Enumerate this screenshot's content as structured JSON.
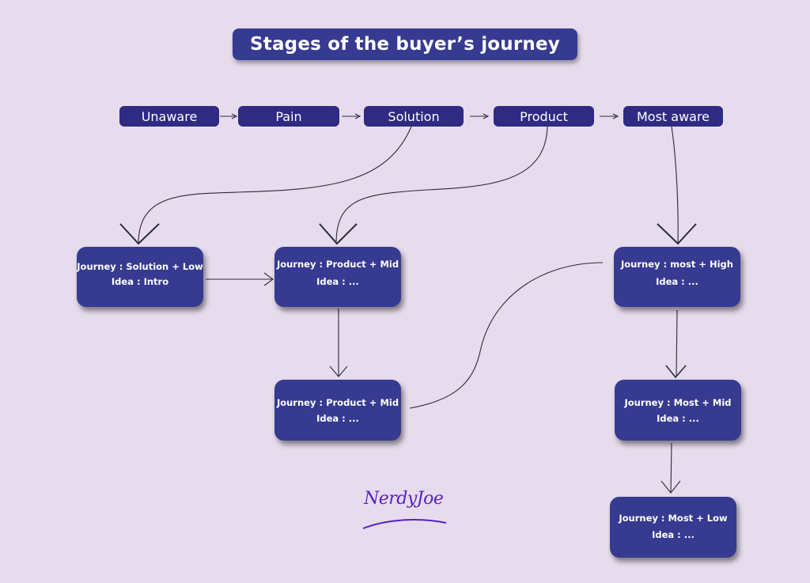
{
  "title": "Stages of the buyer’s journey",
  "stages": [
    {
      "label": "Unaware"
    },
    {
      "label": "Pain"
    },
    {
      "label": "Solution"
    },
    {
      "label": "Product"
    },
    {
      "label": "Most aware"
    }
  ],
  "cards": [
    {
      "journey": "Journey : Solution + Low",
      "idea": "Idea : Intro"
    },
    {
      "journey": "Journey : Product + Mid",
      "idea": "Idea : ..."
    },
    {
      "journey": "Journey : Product + Mid",
      "idea": "Idea : ..."
    },
    {
      "journey": "Journey : most + High",
      "idea": "Idea : ..."
    },
    {
      "journey": "Journey : Most + Mid",
      "idea": "Idea : ..."
    },
    {
      "journey": "Journey : Most + Low",
      "idea": "Idea : ..."
    }
  ],
  "logo": {
    "text": "NerdyJoe"
  },
  "colors": {
    "background": "#e6dced",
    "stage": "#2f2a82",
    "card": "#363a91",
    "logo": "#5a1fc8"
  }
}
